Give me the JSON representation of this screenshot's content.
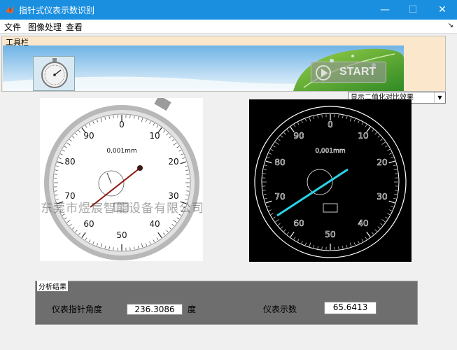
{
  "window": {
    "title": "指针式仪表示数识别"
  },
  "menu": {
    "items": [
      "文件",
      "图像处理",
      "查看"
    ],
    "dock_glyph": "↘"
  },
  "toolbar": {
    "label": "工具栏",
    "start_label": "START"
  },
  "select": {
    "value": "显示二值化对比效果"
  },
  "dial": {
    "ticks": [
      "0",
      "10",
      "20",
      "30",
      "40",
      "50",
      "60",
      "70",
      "80",
      "90"
    ],
    "unit_text": "0,001mm"
  },
  "results": {
    "group_label": "分析结果",
    "angle_label": "仪表指针角度",
    "angle_value": "236.3086",
    "angle_unit": "度",
    "reading_label": "仪表示数",
    "reading_value": "65.6413"
  },
  "watermark": {
    "text": "东莞市煜宸智能设备有限公司"
  }
}
